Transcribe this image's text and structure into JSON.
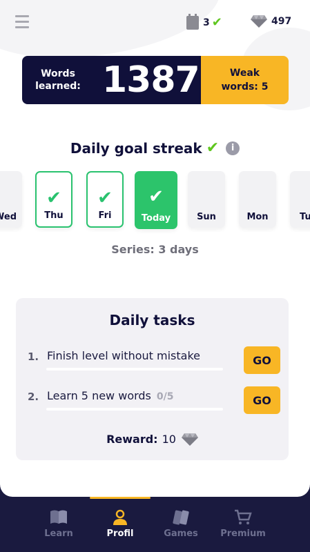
{
  "header": {
    "streak_count": "3",
    "gems": "497"
  },
  "words": {
    "label": "Words learned:",
    "count": "1387",
    "weak_label": "Weak words: 5"
  },
  "streak": {
    "title": "Daily goal streak",
    "info_icon": "i",
    "days": [
      {
        "label": "Wed",
        "state": "plain"
      },
      {
        "label": "Thu",
        "state": "done"
      },
      {
        "label": "Fri",
        "state": "done"
      },
      {
        "label": "Today",
        "state": "today"
      },
      {
        "label": "Sun",
        "state": "plain"
      },
      {
        "label": "Mon",
        "state": "plain"
      },
      {
        "label": "Tue",
        "state": "plain"
      }
    ],
    "series": "Series: 3 days"
  },
  "tasks": {
    "title": "Daily tasks",
    "items": [
      {
        "num": "1.",
        "text": "Finish level without mistake",
        "progress": "",
        "button": "GO"
      },
      {
        "num": "2.",
        "text": "Learn 5 new words",
        "progress": "0/5",
        "button": "GO"
      }
    ],
    "reward_label": "Reward:",
    "reward_value": "10"
  },
  "nav": {
    "items": [
      {
        "label": "Learn",
        "icon": "book-icon"
      },
      {
        "label": "Profil",
        "icon": "user-icon"
      },
      {
        "label": "Games",
        "icon": "cards-icon"
      },
      {
        "label": "Premium",
        "icon": "cart-icon"
      }
    ],
    "active": "Profil"
  },
  "colors": {
    "navy": "#10103a",
    "accent": "#f8b625",
    "green": "#2cc46b"
  }
}
